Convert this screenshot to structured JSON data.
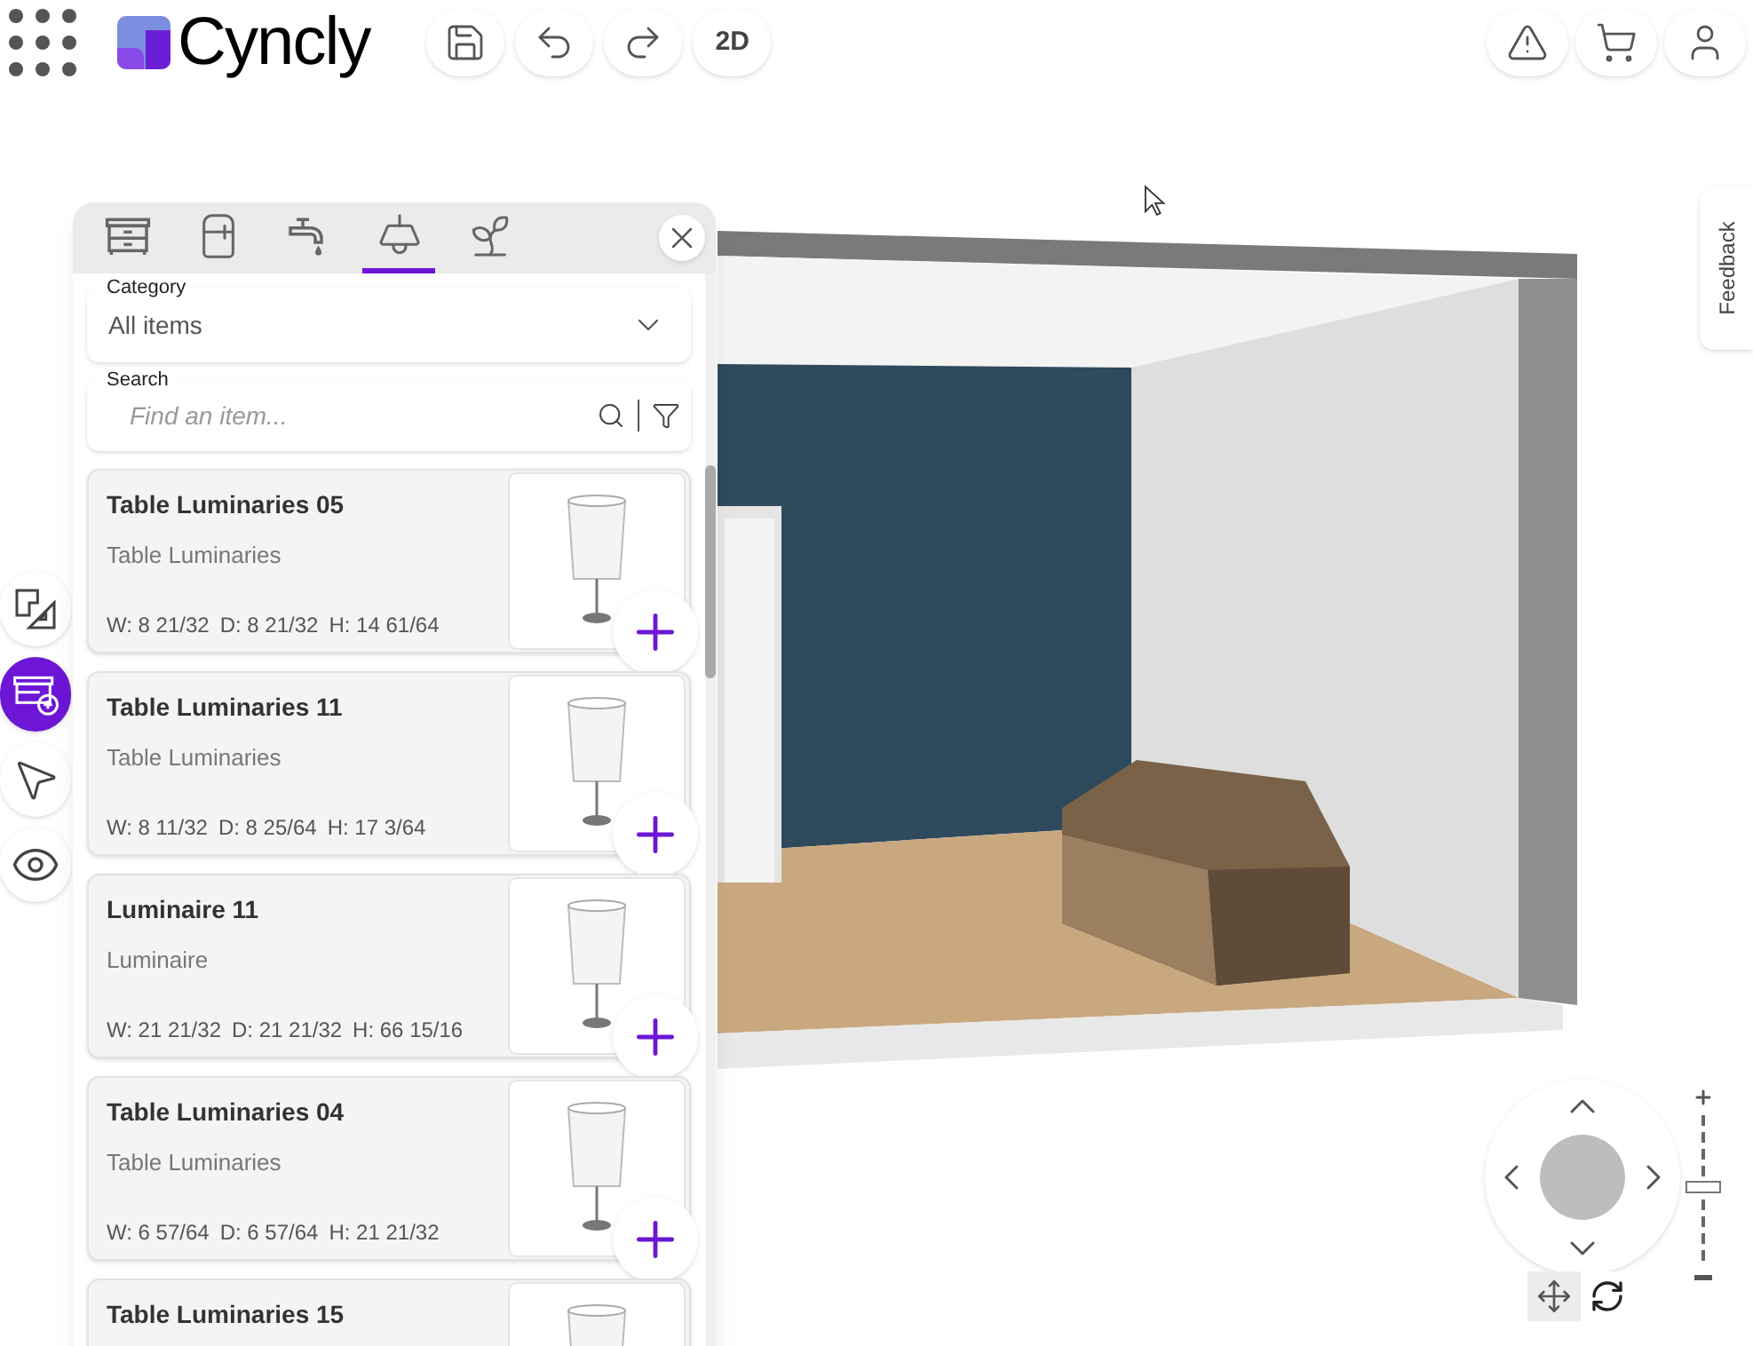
{
  "header": {
    "logo_text": "Cyncly",
    "view_button": "2D"
  },
  "side_tools": [
    {
      "kind": "plan",
      "selected": false
    },
    {
      "kind": "furniture",
      "selected": true
    },
    {
      "kind": "pointer",
      "selected": false
    },
    {
      "kind": "view",
      "selected": false
    }
  ],
  "panel": {
    "tabs": [
      {
        "kind": "cabinet",
        "selected": false
      },
      {
        "kind": "appliance",
        "selected": false
      },
      {
        "kind": "faucet",
        "selected": false
      },
      {
        "kind": "lamp",
        "selected": true
      },
      {
        "kind": "plant",
        "selected": false
      }
    ],
    "category": {
      "label": "Category",
      "value": "All items"
    },
    "search": {
      "label": "Search",
      "placeholder": "Find an item..."
    },
    "items": [
      {
        "name": "Table Luminaries 05",
        "category": "Table Luminaries",
        "w": "W: 8 21/32",
        "d": "D: 8 21/32",
        "h": "H: 14 61/64"
      },
      {
        "name": "Table Luminaries 11",
        "category": "Table Luminaries",
        "w": "W: 8 11/32",
        "d": "D: 8 25/64",
        "h": "H: 17 3/64"
      },
      {
        "name": "Luminaire 11",
        "category": "Luminaire",
        "w": "W: 21 21/32",
        "d": "D: 21 21/32",
        "h": "H: 66 15/16"
      },
      {
        "name": "Table Luminaries 04",
        "category": "Table Luminaries",
        "w": "W: 6 57/64",
        "d": "D: 6 57/64",
        "h": "H: 21 21/32"
      },
      {
        "name": "Table Luminaries 15"
      }
    ]
  },
  "feedback": "Feedback",
  "navigation": {
    "modes": [
      {
        "kind": "move",
        "selected": true
      },
      {
        "kind": "rotate",
        "selected": false
      }
    ],
    "zoom": {
      "level": 0.5
    }
  }
}
